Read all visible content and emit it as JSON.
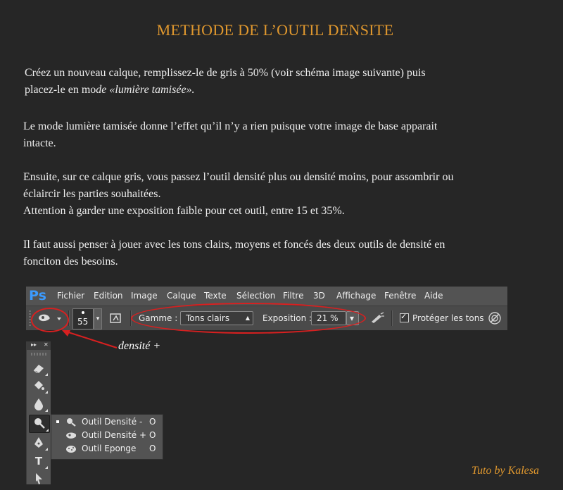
{
  "title": "METHODE DE L’OUTIL DENSITE",
  "paragraphs": {
    "p1_line1": "Créez un nouveau calque, remplissez-le  de gris à 50% (voir schéma image suivante) puis",
    "p1_line2_start": "placez-le en mo",
    "p1_line2_italic": "de  «lumière tamisée».",
    "p2_line1": "Le mode lumière tamisée donne l’effet qu’il n’y a  rien puisque votre image de base apparait",
    "p2_line2": "intacte.",
    "p3_line1": "Ensuite, sur ce calque gris, vous passez l’outil densité plus ou densité moins, pour assombrir ou",
    "p3_line2": "éclaircir les parties souhaitées.",
    "p3_line3": "Attention à garder une exposition faible pour cet outil, entre 15 et 35%.",
    "p4_line1": "Il faut aussi penser à jouer avec les tons clairs, moyens et foncés des deux outils de densité en",
    "p4_line2": "fonciton des besoins."
  },
  "photoshop": {
    "logo": "Ps",
    "menu": [
      "Fichier",
      "Edition",
      "Image",
      "Calque",
      "Texte",
      "Sélection",
      "Filtre",
      "3D",
      "Affichage",
      "Fenêtre",
      "Aide"
    ],
    "options": {
      "brush_size": "55",
      "gamme_label": "Gamme :",
      "gamme_value": "Tons clairs",
      "exposition_label": "Exposition :",
      "exposition_value": "21 %",
      "protect_tones_label": "Protéger les tons",
      "protect_tones_checked": true
    },
    "flyout": [
      {
        "label": "Outil Densité -",
        "key": "O",
        "active": true,
        "icon": "dodge-icon"
      },
      {
        "label": "Outil Densité +",
        "key": "O",
        "active": false,
        "icon": "burn-icon"
      },
      {
        "label": "Outil Eponge",
        "key": "O",
        "active": false,
        "icon": "sponge-icon"
      }
    ],
    "panel_header": {
      "collapse": "▸▸",
      "close": "✕"
    }
  },
  "annotation": "densité +",
  "credit": "Tuto by Kalesa",
  "colors": {
    "accent": "#e0982e",
    "highlight": "#d82020",
    "ps_blue": "#3c9bff"
  }
}
